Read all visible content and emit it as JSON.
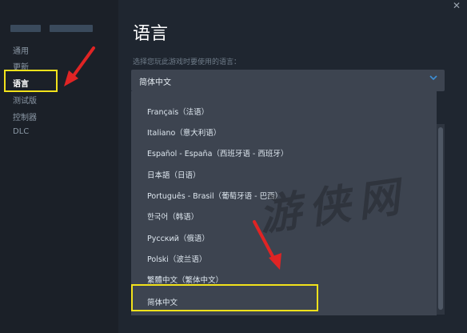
{
  "sidebar": {
    "items": [
      {
        "label": "通用",
        "active": false
      },
      {
        "label": "更新",
        "active": false
      },
      {
        "label": "语言",
        "active": true
      },
      {
        "label": "测试版",
        "active": false
      },
      {
        "label": "控制器",
        "active": false
      },
      {
        "label": "DLC",
        "active": false
      }
    ]
  },
  "header": {
    "title": "语言",
    "close_icon": "close-icon"
  },
  "language_select": {
    "prompt": "选择您玩此游戏时要使用的语言：",
    "selected": "简体中文",
    "options": [
      "Français（法语）",
      "Italiano（意大利语）",
      "Español - España（西班牙语 - 西班牙）",
      "日本語（日语）",
      "Português - Brasil（葡萄牙语 - 巴西）",
      "한국어（韩语）",
      "Русский（俄语）",
      "Polski（波兰语）",
      "繁體中文（繁体中文）",
      "简体中文"
    ]
  },
  "watermark": "游侠网",
  "colors": {
    "highlight": "#f2e21b",
    "arrow": "#e02424",
    "accent": "#3d8fd6"
  }
}
